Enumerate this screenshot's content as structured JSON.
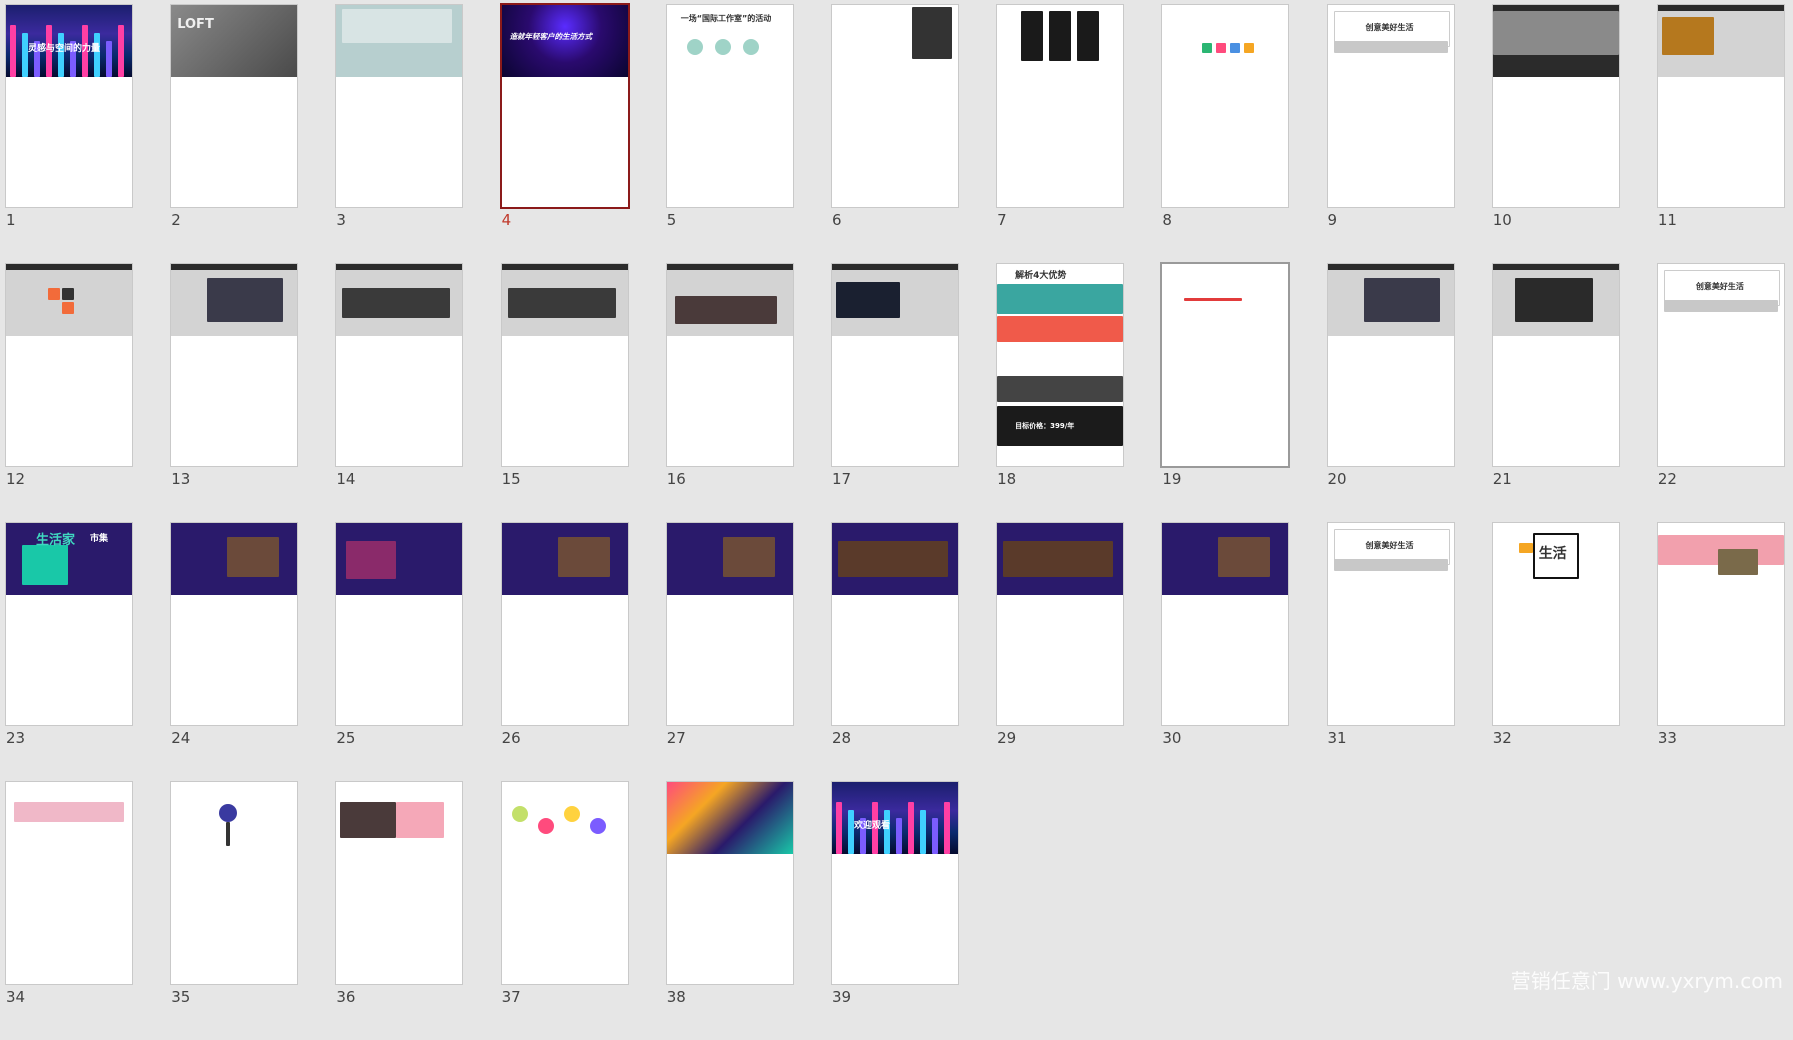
{
  "selected_page": "4",
  "pages": [
    {
      "num": "1",
      "title": "灵感与空间的力量",
      "theme": "city-night"
    },
    {
      "num": "2",
      "title": "LOFT",
      "theme": "gray-photo"
    },
    {
      "num": "3",
      "title": "",
      "theme": "teal-photo"
    },
    {
      "num": "4",
      "title": "造就年轻客户的生活方式",
      "theme": "purple-tunnel"
    },
    {
      "num": "5",
      "title": "一场“国际工作室”的活动",
      "theme": "white-circles"
    },
    {
      "num": "6",
      "title": "",
      "theme": "white-text-photo"
    },
    {
      "num": "7",
      "title": "",
      "theme": "phones"
    },
    {
      "num": "8",
      "title": "",
      "theme": "white-icons"
    },
    {
      "num": "9",
      "title": "创意美好生活",
      "theme": "white-band"
    },
    {
      "num": "10",
      "title": "",
      "theme": "gray-dark-photo"
    },
    {
      "num": "11",
      "title": "",
      "theme": "gray-warm-photo"
    },
    {
      "num": "12",
      "title": "",
      "theme": "gray-orange"
    },
    {
      "num": "13",
      "title": "",
      "theme": "gray-photo-right"
    },
    {
      "num": "14",
      "title": "",
      "theme": "gray-photos3"
    },
    {
      "num": "15",
      "title": "",
      "theme": "gray-photos3"
    },
    {
      "num": "16",
      "title": "",
      "theme": "gray-photos4"
    },
    {
      "num": "17",
      "title": "",
      "theme": "gray-night-photo"
    },
    {
      "num": "18",
      "title": "解析4大优势",
      "price": "目标价格：399/年",
      "theme": "long-page"
    },
    {
      "num": "19",
      "title": "",
      "theme": "white-doc"
    },
    {
      "num": "20",
      "title": "",
      "theme": "gray-photos-right"
    },
    {
      "num": "21",
      "title": "",
      "theme": "gray-collage"
    },
    {
      "num": "22",
      "title": "创意美好生活",
      "theme": "white-band"
    },
    {
      "num": "23",
      "title": "生活家",
      "title2": "市集",
      "theme": "purple-iso"
    },
    {
      "num": "24",
      "title": "",
      "theme": "purple-photo"
    },
    {
      "num": "25",
      "title": "",
      "theme": "purple-photo-left"
    },
    {
      "num": "26",
      "title": "",
      "theme": "purple-photo"
    },
    {
      "num": "27",
      "title": "",
      "theme": "purple-photo"
    },
    {
      "num": "28",
      "title": "",
      "theme": "purple-photos-wide"
    },
    {
      "num": "29",
      "title": "",
      "theme": "purple-photos-wide"
    },
    {
      "num": "30",
      "title": "",
      "theme": "purple-photo"
    },
    {
      "num": "31",
      "title": "创意美好生活",
      "theme": "white-band"
    },
    {
      "num": "32",
      "title": "生活",
      "theme": "white-splash"
    },
    {
      "num": "33",
      "title": "",
      "theme": "pink-laptop"
    },
    {
      "num": "34",
      "title": "",
      "theme": "white-city"
    },
    {
      "num": "35",
      "title": "",
      "theme": "white-tree"
    },
    {
      "num": "36",
      "title": "",
      "theme": "pink-photo"
    },
    {
      "num": "37",
      "title": "",
      "theme": "white-flowers"
    },
    {
      "num": "38",
      "title": "",
      "theme": "color-collage"
    },
    {
      "num": "39",
      "title": "欢迎观看",
      "theme": "city-night"
    }
  ],
  "watermark": "营销任意门 www.yxrym.com",
  "colors": {
    "selected": "#8b1a1a",
    "purple": "#2a1a6b",
    "gray": "#d3d3d3"
  }
}
